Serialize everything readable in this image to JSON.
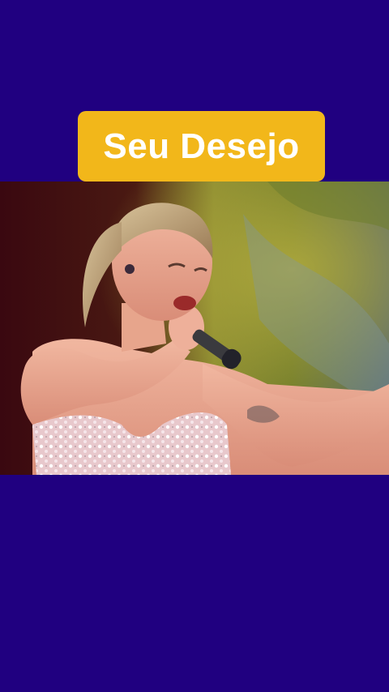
{
  "title": {
    "text": "Seu Desejo"
  },
  "video": {
    "description_icon": "performer-singing-image"
  },
  "colors": {
    "background": "#200080",
    "badge": "#f2b71a",
    "badge_text": "#ffffff"
  }
}
